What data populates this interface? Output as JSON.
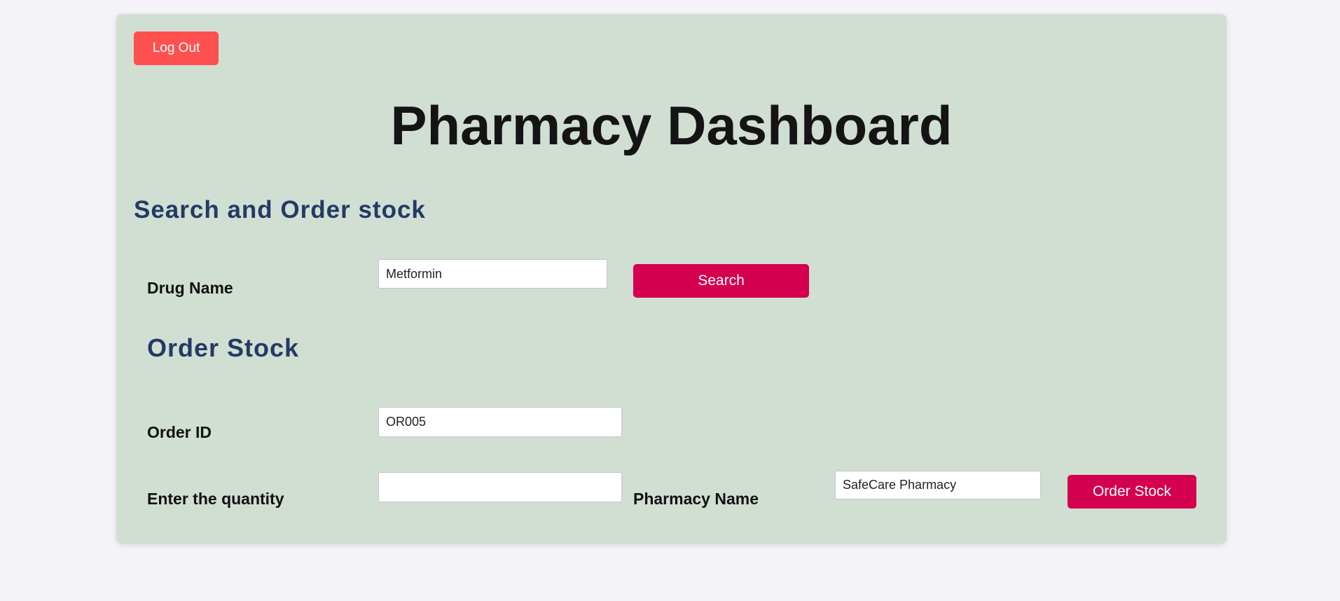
{
  "header": {
    "logout_label": "Log Out",
    "title": "Pharmacy Dashboard"
  },
  "search_section": {
    "title": "Search and Order stock",
    "drug_name_label": "Drug Name",
    "drug_name_value": "Metformin",
    "search_label": "Search"
  },
  "order_section": {
    "title": "Order Stock",
    "order_id_label": "Order ID",
    "order_id_value": "OR005",
    "quantity_label": "Enter the quantity",
    "quantity_value": "",
    "pharmacy_name_label": "Pharmacy Name",
    "pharmacy_name_value": "SafeCare Pharmacy",
    "order_button_label": "Order Stock"
  },
  "colors": {
    "page_background": "#f3f3f8",
    "card_background": "#d1ded2",
    "logout_button": "#ff5050",
    "primary_button": "#d4004f",
    "section_heading": "#243a66"
  }
}
